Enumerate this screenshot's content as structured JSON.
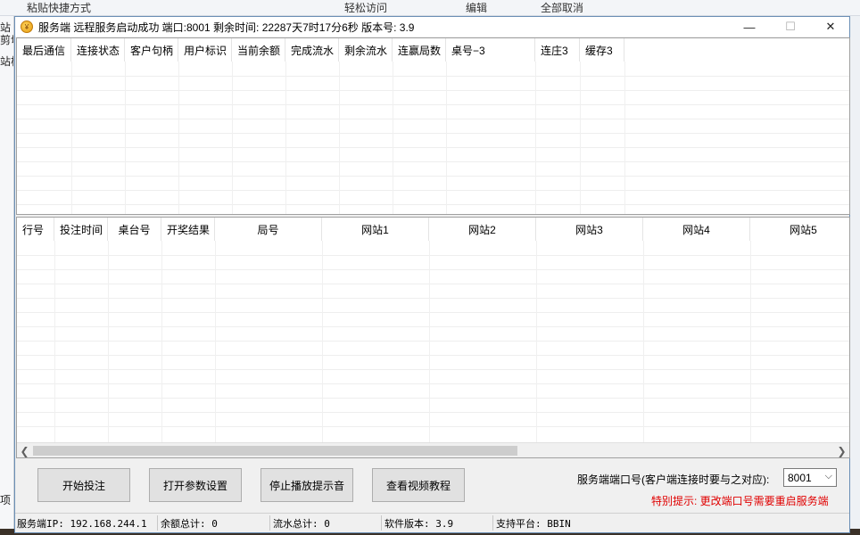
{
  "background": {
    "top_items": [
      "粘贴快捷方式",
      "轻松访问",
      "编辑",
      "全部取消"
    ],
    "left_items": [
      "站",
      "剪切",
      "站板",
      "项"
    ]
  },
  "window": {
    "title": "服务端 远程服务启动成功 端口:8001 剩余时间:  22287天7时17分6秒  版本号:  3.9",
    "minimize": "—",
    "maximize": "☐",
    "close": "✕"
  },
  "client_table": {
    "headers": [
      "最后通信",
      "连接状态",
      "客户句柄",
      "用户标识",
      "当前余额",
      "完成流水",
      "剩余流水",
      "连赢局数",
      "桌号−3",
      "连庄3",
      "缓存3"
    ]
  },
  "bet_table": {
    "headers": [
      "行号",
      "投注时间",
      "桌台号",
      "开奖结果",
      "局号",
      "网站1",
      "网站2",
      "网站3",
      "网站4",
      "网站5"
    ]
  },
  "scrollbar": {
    "left_arrow": "❮",
    "right_arrow": "❯"
  },
  "buttons": {
    "start_bet": "开始投注",
    "open_params": "打开参数设置",
    "stop_sound": "停止播放提示音",
    "view_tutorial": "查看视频教程"
  },
  "port": {
    "label": "服务端端口号(客户端连接时要与之对应):",
    "value": "8001",
    "hint": "特别提示: 更改端口号需要重启服务端"
  },
  "status": {
    "server_ip": "服务端IP: 192.168.244.1",
    "balance_total": "余额总计:  0",
    "flow_total": "流水总计:  0",
    "version": "软件版本:  3.9",
    "platform": "支持平台:   BBIN"
  },
  "colors": {
    "hint": "#e00000",
    "window_border": "#6b8fb5",
    "grid_bg": "#ffffff"
  }
}
